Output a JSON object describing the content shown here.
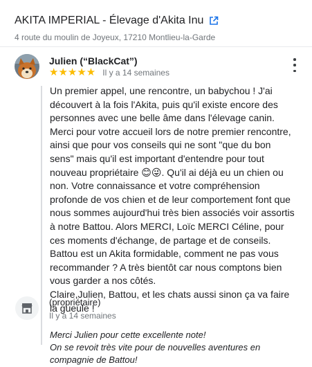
{
  "header": {
    "title": "AKITA IMPERIAL - Élevage d'Akita Inu",
    "address": "4 route du moulin de Joyeux, 17210 Montlieu-la-Garde",
    "link_icon": "external-link-icon"
  },
  "review": {
    "reviewer_name": "Julien (“BlackCat”)",
    "stars": "★★★★★",
    "rating": 5,
    "date": "Il y a 14 semaines",
    "text": "Un premier appel, une rencontre, un babychou ! J'ai découvert à la fois l'Akita, puis qu'il existe encore des personnes avec une belle âme dans l'élevage canin.\nMerci pour votre accueil lors de notre premier rencontre, ainsi que pour vos conseils qui ne sont \"que du bon sens\" mais qu'il est important d'entendre pour tout nouveau propriétaire 😊😜. Qu'il ai déjà eu un chien ou non. Votre connaissance et votre compréhension profonde de vos chien et de leur comportement font que nous sommes aujourd'hui très bien associés voir assortis à notre Battou. Alors MERCI, Loïc MERCI Céline, pour ces moments d'échange, de partage et de conseils. Battou est un Akita formidable, comment ne pas vous recommander ? A très bientôt car nous comptons bien vous garder a nos côtés.\nClaire,Julien, Battou, et les chats aussi sinon ça va faire la gueule !"
  },
  "owner_reply": {
    "label": "(propriétaire)",
    "date": "Il y a 14 semaines",
    "text": "Merci Julien pour cette excellente note!\nOn se revoit très vite pour de nouvelles aventures en compagnie de Battou!"
  },
  "colors": {
    "star": "#fbbc04",
    "link": "#1a73e8",
    "secondary_text": "#70757a"
  }
}
